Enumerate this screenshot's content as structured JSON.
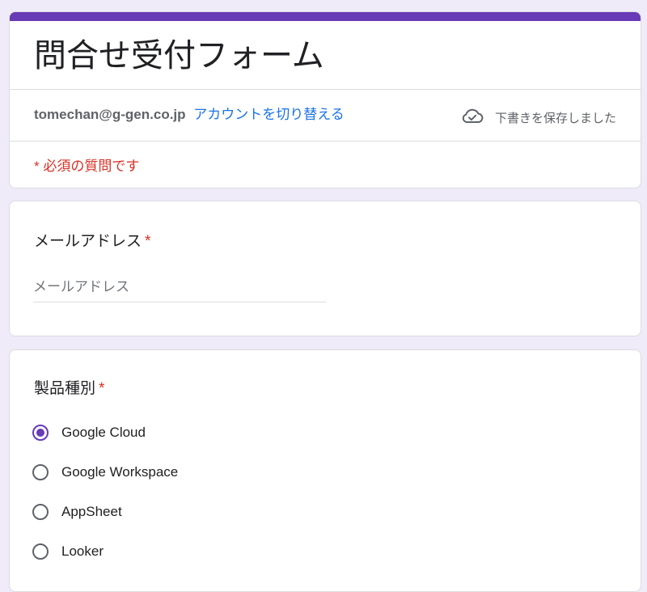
{
  "form": {
    "title": "問合せ受付フォーム",
    "account_email": "tomechan@g-gen.co.jp",
    "switch_account": "アカウントを切り替える",
    "draft_status": "下書きを保存しました",
    "required_note": "* 必須の質問です"
  },
  "questions": {
    "email": {
      "label": "メールアドレス",
      "required_mark": "*",
      "placeholder": "メールアドレス",
      "value": ""
    },
    "product": {
      "label": "製品種別",
      "required_mark": "*",
      "selected": "Google Cloud",
      "options": [
        "Google Cloud",
        "Google Workspace",
        "AppSheet",
        "Looker"
      ]
    }
  },
  "colors": {
    "theme": "#673ab7",
    "background": "#f0ebf8",
    "link": "#1a73e8",
    "required": "#d93025"
  },
  "icons": {
    "draft_status": "cloud-check-icon"
  }
}
